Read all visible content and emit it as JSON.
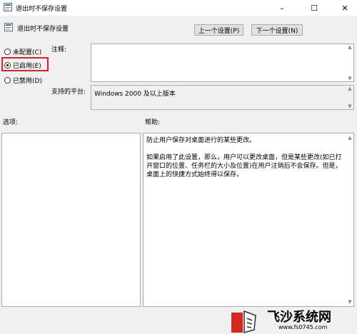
{
  "window": {
    "title": "退出时不保存设置",
    "controls": {
      "minimize": "–",
      "maximize": "☐",
      "close": "✕"
    }
  },
  "header": {
    "setting_name": "退出时不保存设置",
    "prev_button": "上一个设置(P)",
    "next_button": "下一个设置(N)"
  },
  "options_state": {
    "radios": [
      {
        "label": "未配置(C)",
        "checked": false
      },
      {
        "label": "已启用(E)",
        "checked": true
      },
      {
        "label": "已禁用(D)",
        "checked": false
      }
    ]
  },
  "comment": {
    "label": "注释:",
    "value": ""
  },
  "platform": {
    "label": "支持的平台:",
    "value": "Windows 2000 及以上版本"
  },
  "options": {
    "label": "选项:"
  },
  "help": {
    "label": "帮助:",
    "paragraphs": [
      "防止用户保存对桌面进行的某些更改。",
      "如果启用了此设置，那么，用户可以更改桌面，但是某些更改(如已打开窗口的位置、任务栏的大小及位置)在用户注销后不会保存。但是，桌面上的快捷方式始终得以保存。"
    ]
  },
  "watermark": {
    "brand": "飞沙系统网",
    "url": "www.fs0745.com"
  },
  "colors": {
    "highlight": "#e0202a",
    "background": "#f0f0f0"
  }
}
